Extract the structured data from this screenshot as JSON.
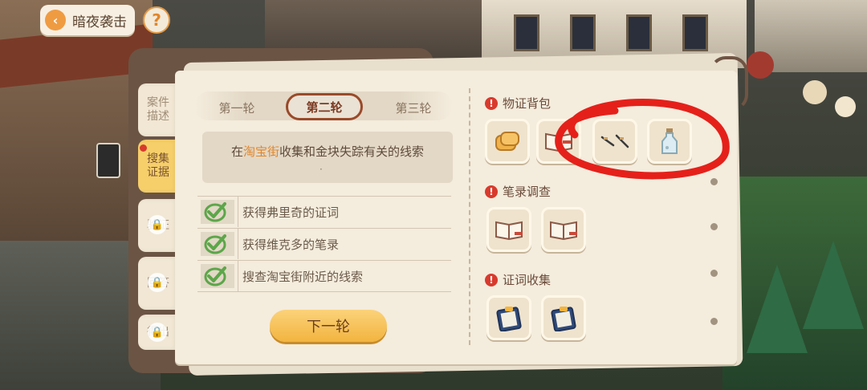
{
  "header": {
    "back_label": "暗夜袭击",
    "help_label": "?"
  },
  "side_tabs": [
    {
      "label": "案件描述",
      "active": false,
      "locked": false
    },
    {
      "label": "搜集证据",
      "active": true,
      "locked": false,
      "alert": true
    },
    {
      "label": "验证",
      "active": false,
      "locked": true
    },
    {
      "label": "回答",
      "active": false,
      "locked": true
    },
    {
      "label": "得出",
      "active": false,
      "locked": true
    }
  ],
  "rounds": [
    {
      "label": "第一轮",
      "active": false
    },
    {
      "label": "第二轮",
      "active": true
    },
    {
      "label": "第三轮",
      "active": false
    }
  ],
  "mission": {
    "prefix": "在",
    "highlight": "淘宝街",
    "suffix": "收集和金块失踪有关的线索",
    "dot": "·"
  },
  "tasks": [
    {
      "text": "获得弗里奇的证词",
      "done": true
    },
    {
      "text": "获得维克多的笔录",
      "done": true
    },
    {
      "text": "搜查淘宝街附近的线索",
      "done": true
    }
  ],
  "next_button": "下一轮",
  "evidence_sections": [
    {
      "title": "物证背包",
      "items": [
        "bread-icon",
        "open-book-icon",
        "tweezers-icon",
        "bottle-icon"
      ]
    },
    {
      "title": "笔录调查",
      "items": [
        "notebook-icon",
        "notebook-icon"
      ]
    },
    {
      "title": "证词收集",
      "items": [
        "clipboard-icon",
        "clipboard-icon"
      ]
    }
  ],
  "colors": {
    "accent_orange": "#e0862b",
    "active_tab_yellow": "#f6cf6a",
    "alert_red": "#d83a2d",
    "check_green": "#5da64a",
    "annotation_red": "#e5201a"
  }
}
